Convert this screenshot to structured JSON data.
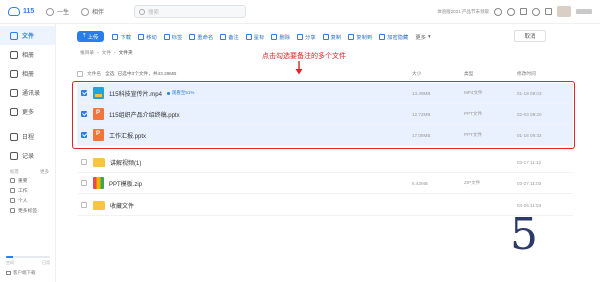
{
  "app": {
    "name": "115"
  },
  "topnav": [
    {
      "label": "一生"
    },
    {
      "label": "相伴"
    }
  ],
  "search": {
    "placeholder": "搜索"
  },
  "topright": {
    "vip_text": "体验版2021 产品节未领取"
  },
  "sidebar": {
    "items": [
      {
        "label": "文件",
        "icon": "folder-icon",
        "active": true
      },
      {
        "label": "相册",
        "icon": "headphone-icon"
      },
      {
        "label": "相册",
        "icon": "image-icon"
      },
      {
        "label": "通讯录",
        "icon": "contacts-icon"
      },
      {
        "label": "更多",
        "icon": "more-icon"
      },
      {
        "label": "日程",
        "icon": "calendar-icon"
      },
      {
        "label": "记录",
        "icon": "note-icon"
      }
    ],
    "tags_header": {
      "left": "标签",
      "right": "更多"
    },
    "tags": [
      {
        "label": "重要"
      },
      {
        "label": "工作"
      },
      {
        "label": "个人"
      },
      {
        "label": "更多标签"
      }
    ],
    "storage": {
      "used": "空间",
      "total": "已用",
      "fill_fraction": 0.15
    },
    "client": "客户端下载"
  },
  "toolbar": {
    "upload": "上传",
    "buttons": [
      {
        "label": "下载",
        "icon": "download-icon"
      },
      {
        "label": "移动",
        "icon": "move-icon"
      },
      {
        "label": "标签",
        "icon": "tag-icon"
      },
      {
        "label": "重命名",
        "icon": "rename-icon"
      },
      {
        "label": "备注",
        "icon": "note-icon"
      },
      {
        "label": "星标",
        "icon": "star-icon"
      },
      {
        "label": "删除",
        "icon": "delete-icon"
      },
      {
        "label": "分享",
        "icon": "share-icon"
      },
      {
        "label": "复制",
        "icon": "copy-icon"
      },
      {
        "label": "复制到",
        "icon": "copyto-icon"
      },
      {
        "label": "加密隐藏",
        "icon": "lock-icon"
      }
    ],
    "more": "更多",
    "cancel": "取消"
  },
  "breadcrumb": [
    "根目录",
    "文件",
    "文件夹"
  ],
  "annotation": "点击勾选要备注的多个文件",
  "columns": {
    "name": "文件名",
    "select_all": "全选",
    "selected_info": "已选中3个文件，共43.29MB",
    "size": "大小",
    "type": "类型",
    "time": "修改时间"
  },
  "files": [
    {
      "name": "115科技宣传片.mp4",
      "icon": "video-file-icon",
      "kind": "mp4",
      "selected": true,
      "sub": "观看至51%",
      "size": "13.49MB",
      "type": "MP4文件",
      "time": "01-19 09:03"
    },
    {
      "name": "115组织产品介绍终稿.pptx",
      "icon": "ppt-file-icon",
      "kind": "ppt",
      "selected": true,
      "sub": "",
      "size": "12.72MB",
      "type": "PPT文件",
      "time": "02-03 09:20"
    },
    {
      "name": "工作汇报.pptx",
      "icon": "ppt-file-icon",
      "kind": "ppt",
      "selected": true,
      "sub": "",
      "size": "17.08MB",
      "type": "PPT文件",
      "time": "01-16 09:32"
    },
    {
      "name": "讲解视频(1)",
      "icon": "folder-icon",
      "kind": "folder",
      "selected": false,
      "sub": "",
      "size": "",
      "type": "",
      "time": "03-17 11:12"
    },
    {
      "name": "PPT模板.zip",
      "icon": "zip-file-icon",
      "kind": "zip",
      "selected": false,
      "sub": "",
      "size": "6.43MB",
      "type": "ZIP文件",
      "time": "03-27 11:03"
    },
    {
      "name": "收藏文件",
      "icon": "folder-icon",
      "kind": "folder",
      "selected": false,
      "sub": "",
      "size": "",
      "type": "",
      "time": "04-25 11:53"
    }
  ],
  "watermark": "5",
  "colors": {
    "accent": "#2b7de9",
    "annotation": "#e02424",
    "selected_row": "#e8f1fd"
  }
}
